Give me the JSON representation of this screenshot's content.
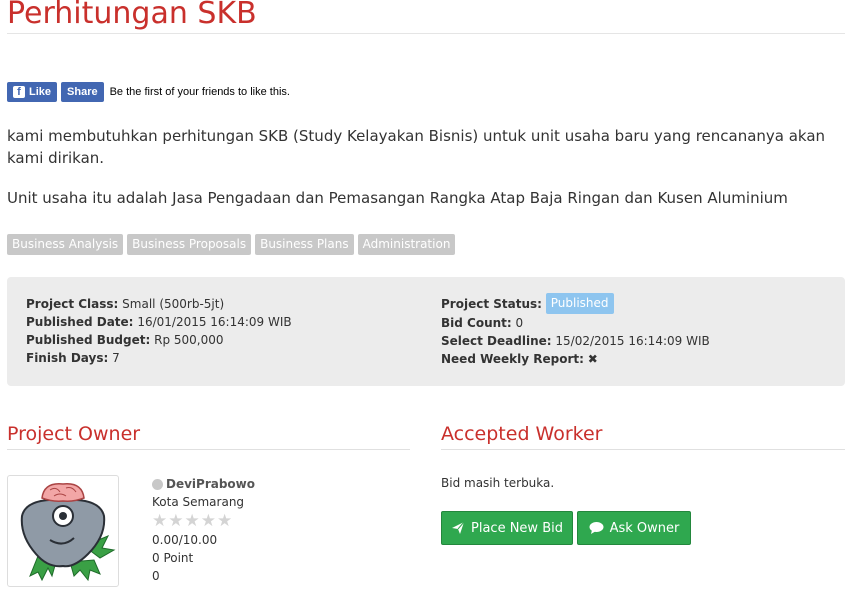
{
  "page": {
    "title": "Perhitungan SKB"
  },
  "facebook": {
    "like_label": "Like",
    "share_label": "Share",
    "social_text": "Be the first of your friends to like this."
  },
  "description": {
    "paragraphs": [
      "kami membutuhkan perhitungan SKB (Study Kelayakan Bisnis) untuk unit usaha baru yang rencananya akan kami dirikan.",
      "Unit usaha itu adalah Jasa Pengadaan dan Pemasangan Rangka Atap Baja Ringan dan Kusen Aluminium"
    ]
  },
  "tags": [
    "Business Analysis",
    "Business Proposals",
    "Business Plans",
    "Administration"
  ],
  "project": {
    "class_label": "Project Class:",
    "class_value": "Small (500rb-5jt)",
    "published_date_label": "Published Date:",
    "published_date_value": "16/01/2015 16:14:09 WIB",
    "budget_label": "Published Budget:",
    "budget_value": "Rp 500,000",
    "finish_days_label": "Finish Days:",
    "finish_days_value": "7",
    "status_label": "Project Status:",
    "status_value": "Published",
    "bid_count_label": "Bid Count:",
    "bid_count_value": "0",
    "deadline_label": "Select Deadline:",
    "deadline_value": "15/02/2015 16:14:09 WIB",
    "weekly_report_label": "Need Weekly Report:",
    "weekly_report_icon": "x-icon"
  },
  "owner_section": {
    "heading": "Project Owner",
    "name": "DeviPrabowo",
    "city": "Kota Semarang",
    "rating_stars": 0,
    "rating_max": 5,
    "rating_text": "0.00/10.00",
    "points": "0 Point",
    "count": "0"
  },
  "worker_section": {
    "heading": "Accepted Worker",
    "status_text": "Bid masih terbuka.",
    "place_bid_label": "Place New Bid",
    "ask_owner_label": "Ask Owner"
  },
  "colors": {
    "accent": "#c9302c",
    "button_green": "#2fa84f",
    "status_badge": "#8ec5ef",
    "tag_bg": "#c8c8c8",
    "panel_bg": "#ececec",
    "facebook": "#4267b2"
  }
}
